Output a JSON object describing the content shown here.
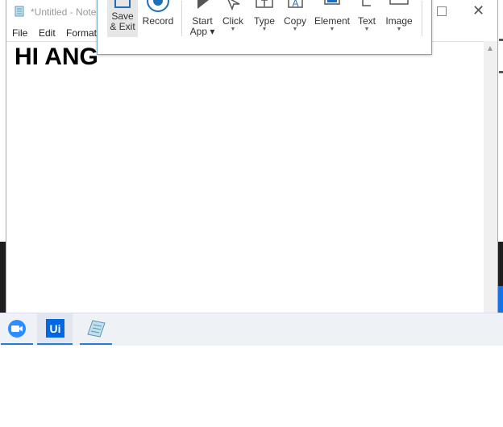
{
  "notepad": {
    "title": "*Untitled - Notepad",
    "menu": [
      "File",
      "Edit",
      "Format"
    ],
    "content": "HI ANG"
  },
  "recorder": {
    "buttons": [
      {
        "label_lines": [
          "Save",
          "& Exit"
        ],
        "icon": "floppy-disk-icon"
      },
      {
        "label_lines": [
          "Record"
        ],
        "icon": "record-icon"
      },
      {
        "label_lines": [
          "Start",
          "App"
        ],
        "icon": "play-icon",
        "dropdown": true
      },
      {
        "label_lines": [
          "Click"
        ],
        "icon": "pointer-icon",
        "dropdown": true
      },
      {
        "label_lines": [
          "Type"
        ],
        "icon": "type-icon",
        "dropdown": true
      },
      {
        "label_lines": [
          "Copy"
        ],
        "icon": "copy-text-icon",
        "dropdown": true
      },
      {
        "label_lines": [
          "Element"
        ],
        "icon": "element-icon",
        "dropdown": true
      },
      {
        "label_lines": [
          "Text"
        ],
        "icon": "text-icon",
        "dropdown": true
      },
      {
        "label_lines": [
          "Image"
        ],
        "icon": "image-icon",
        "dropdown": true
      }
    ]
  },
  "taskbar": {
    "apps": [
      {
        "name": "zoom",
        "icon": "zoom-camera-icon"
      },
      {
        "name": "uipath",
        "icon": "uipath-icon",
        "label": "Ui"
      },
      {
        "name": "notepad",
        "icon": "notepad-icon"
      }
    ]
  },
  "colors": {
    "accent": "#2b7bd6",
    "uipath_blue": "#0067df",
    "zoom_blue": "#2d8cff",
    "dark": "#1e1e1e"
  }
}
